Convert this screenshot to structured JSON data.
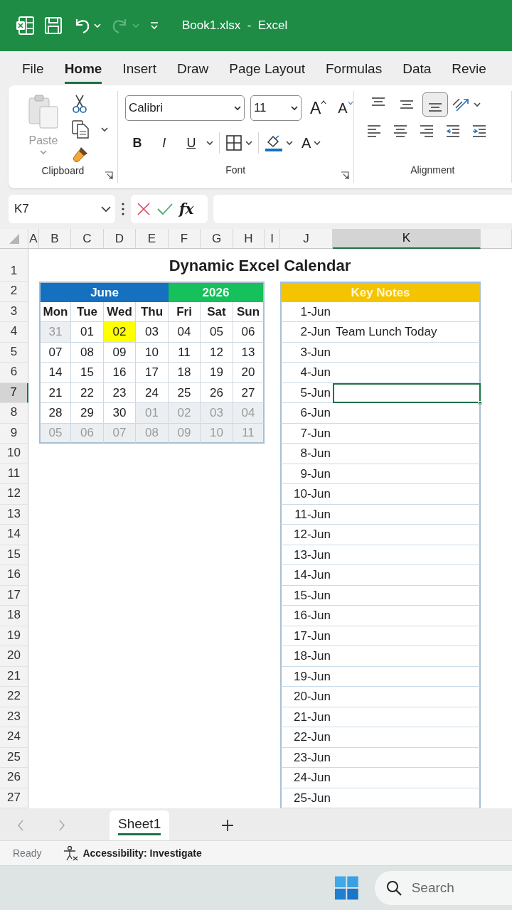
{
  "title_bar": {
    "title": "Book1.xlsx  -  Excel",
    "quick_access": [
      {
        "kind": "save",
        "disabled": false
      },
      {
        "kind": "undo",
        "disabled": false
      },
      {
        "kind": "redo",
        "disabled": true
      }
    ]
  },
  "ribbon_tabs": [
    {
      "label": "File",
      "selected": false
    },
    {
      "label": "Home",
      "selected": true
    },
    {
      "label": "Insert",
      "selected": false
    },
    {
      "label": "Draw",
      "selected": false
    },
    {
      "label": "Page Layout",
      "selected": false
    },
    {
      "label": "Formulas",
      "selected": false
    },
    {
      "label": "Data",
      "selected": false
    },
    {
      "label": "Revie",
      "selected": false
    }
  ],
  "ribbon": {
    "clipboard": {
      "paste": {
        "label": "Paste",
        "disabled": true
      },
      "group_label": "Clipboard"
    },
    "font": {
      "font_name": "Calibri",
      "font_size": "11",
      "grow": "A",
      "shrink": "A",
      "styles": [
        {
          "kind": "bold",
          "label": "B"
        },
        {
          "kind": "italic",
          "label": "I"
        },
        {
          "kind": "underline",
          "label": "U"
        }
      ],
      "color_letter": "A",
      "group_label": "Font"
    },
    "alignment": {
      "vertical": [
        {
          "kind": "top",
          "selected": false
        },
        {
          "kind": "middle",
          "selected": false
        },
        {
          "kind": "bottom",
          "selected": true
        }
      ],
      "horizontal": [
        {
          "kind": "left"
        },
        {
          "kind": "center"
        },
        {
          "kind": "right"
        },
        {
          "kind": "outdent"
        },
        {
          "kind": "indent"
        }
      ],
      "group_label": "Alignment"
    }
  },
  "formula_bar": {
    "name_box": "K7",
    "function_label": "fx"
  },
  "columns": [
    {
      "label": "A",
      "selected": false
    },
    {
      "label": "B",
      "selected": false
    },
    {
      "label": "C",
      "selected": false
    },
    {
      "label": "D",
      "selected": false
    },
    {
      "label": "E",
      "selected": false
    },
    {
      "label": "F",
      "selected": false
    },
    {
      "label": "G",
      "selected": false
    },
    {
      "label": "H",
      "selected": false
    },
    {
      "label": "I",
      "selected": false
    },
    {
      "label": "J",
      "selected": false
    },
    {
      "label": "K",
      "selected": true
    }
  ],
  "rows": [
    {
      "label": "1",
      "selected": false
    },
    {
      "label": "2",
      "selected": false
    },
    {
      "label": "3",
      "selected": false
    },
    {
      "label": "4",
      "selected": false
    },
    {
      "label": "5",
      "selected": false
    },
    {
      "label": "6",
      "selected": false
    },
    {
      "label": "7",
      "selected": true
    },
    {
      "label": "8",
      "selected": false
    },
    {
      "label": "9",
      "selected": false
    },
    {
      "label": "10",
      "selected": false
    },
    {
      "label": "11",
      "selected": false
    },
    {
      "label": "12",
      "selected": false
    },
    {
      "label": "13",
      "selected": false
    },
    {
      "label": "14",
      "selected": false
    },
    {
      "label": "15",
      "selected": false
    },
    {
      "label": "16",
      "selected": false
    },
    {
      "label": "17",
      "selected": false
    },
    {
      "label": "18",
      "selected": false
    },
    {
      "label": "19",
      "selected": false
    },
    {
      "label": "20",
      "selected": false
    },
    {
      "label": "21",
      "selected": false
    },
    {
      "label": "22",
      "selected": false
    },
    {
      "label": "23",
      "selected": false
    },
    {
      "label": "24",
      "selected": false
    },
    {
      "label": "25",
      "selected": false
    },
    {
      "label": "26",
      "selected": false
    },
    {
      "label": "27",
      "selected": false
    }
  ],
  "sheet_title": "Dynamic Excel Calendar",
  "calendar": {
    "month": "June",
    "year": "2026",
    "weekdays": [
      "Mon",
      "Tue",
      "Wed",
      "Thu",
      "Fri",
      "Sat",
      "Sun"
    ],
    "weeks": [
      [
        {
          "day": "31",
          "in_month": false,
          "today": false
        },
        {
          "day": "01",
          "in_month": true,
          "today": false
        },
        {
          "day": "02",
          "in_month": true,
          "today": true
        },
        {
          "day": "03",
          "in_month": true,
          "today": false
        },
        {
          "day": "04",
          "in_month": true,
          "today": false
        },
        {
          "day": "05",
          "in_month": true,
          "today": false
        },
        {
          "day": "06",
          "in_month": true,
          "today": false
        }
      ],
      [
        {
          "day": "07",
          "in_month": true,
          "today": false
        },
        {
          "day": "08",
          "in_month": true,
          "today": false
        },
        {
          "day": "09",
          "in_month": true,
          "today": false
        },
        {
          "day": "10",
          "in_month": true,
          "today": false
        },
        {
          "day": "11",
          "in_month": true,
          "today": false
        },
        {
          "day": "12",
          "in_month": true,
          "today": false
        },
        {
          "day": "13",
          "in_month": true,
          "today": false
        }
      ],
      [
        {
          "day": "14",
          "in_month": true,
          "today": false
        },
        {
          "day": "15",
          "in_month": true,
          "today": false
        },
        {
          "day": "16",
          "in_month": true,
          "today": false
        },
        {
          "day": "17",
          "in_month": true,
          "today": false
        },
        {
          "day": "18",
          "in_month": true,
          "today": false
        },
        {
          "day": "19",
          "in_month": true,
          "today": false
        },
        {
          "day": "20",
          "in_month": true,
          "today": false
        }
      ],
      [
        {
          "day": "21",
          "in_month": true,
          "today": false
        },
        {
          "day": "22",
          "in_month": true,
          "today": false
        },
        {
          "day": "23",
          "in_month": true,
          "today": false
        },
        {
          "day": "24",
          "in_month": true,
          "today": false
        },
        {
          "day": "25",
          "in_month": true,
          "today": false
        },
        {
          "day": "26",
          "in_month": true,
          "today": false
        },
        {
          "day": "27",
          "in_month": true,
          "today": false
        }
      ],
      [
        {
          "day": "28",
          "in_month": true,
          "today": false
        },
        {
          "day": "29",
          "in_month": true,
          "today": false
        },
        {
          "day": "30",
          "in_month": true,
          "today": false
        },
        {
          "day": "01",
          "in_month": false,
          "today": false
        },
        {
          "day": "02",
          "in_month": false,
          "today": false
        },
        {
          "day": "03",
          "in_month": false,
          "today": false
        },
        {
          "day": "04",
          "in_month": false,
          "today": false
        }
      ],
      [
        {
          "day": "05",
          "in_month": false,
          "today": false
        },
        {
          "day": "06",
          "in_month": false,
          "today": false
        },
        {
          "day": "07",
          "in_month": false,
          "today": false
        },
        {
          "day": "08",
          "in_month": false,
          "today": false
        },
        {
          "day": "09",
          "in_month": false,
          "today": false
        },
        {
          "day": "10",
          "in_month": false,
          "today": false
        },
        {
          "day": "11",
          "in_month": false,
          "today": false
        }
      ]
    ]
  },
  "notes": {
    "header": "Key Notes",
    "rows": [
      {
        "date": "1-Jun",
        "selected": false
      },
      {
        "date": "2-Jun",
        "note": "Team Lunch Today",
        "selected": false
      },
      {
        "date": "3-Jun",
        "selected": false
      },
      {
        "date": "4-Jun",
        "selected": false
      },
      {
        "date": "5-Jun",
        "selected": true
      },
      {
        "date": "6-Jun",
        "selected": false
      },
      {
        "date": "7-Jun",
        "selected": false
      },
      {
        "date": "8-Jun",
        "selected": false
      },
      {
        "date": "9-Jun",
        "selected": false
      },
      {
        "date": "10-Jun",
        "selected": false
      },
      {
        "date": "11-Jun",
        "selected": false
      },
      {
        "date": "12-Jun",
        "selected": false
      },
      {
        "date": "13-Jun",
        "selected": false
      },
      {
        "date": "14-Jun",
        "selected": false
      },
      {
        "date": "15-Jun",
        "selected": false
      },
      {
        "date": "16-Jun",
        "selected": false
      },
      {
        "date": "17-Jun",
        "selected": false
      },
      {
        "date": "18-Jun",
        "selected": false
      },
      {
        "date": "19-Jun",
        "selected": false
      },
      {
        "date": "20-Jun",
        "selected": false
      },
      {
        "date": "21-Jun",
        "selected": false
      },
      {
        "date": "22-Jun",
        "selected": false
      },
      {
        "date": "23-Jun",
        "selected": false
      },
      {
        "date": "24-Jun",
        "selected": false
      },
      {
        "date": "25-Jun",
        "selected": false
      }
    ]
  },
  "sheet_tabs": [
    {
      "label": "Sheet1",
      "selected": true
    }
  ],
  "status_bar": {
    "mode": "Ready",
    "accessibility": "Accessibility: Investigate"
  },
  "taskbar": {
    "search_placeholder": "Search"
  }
}
